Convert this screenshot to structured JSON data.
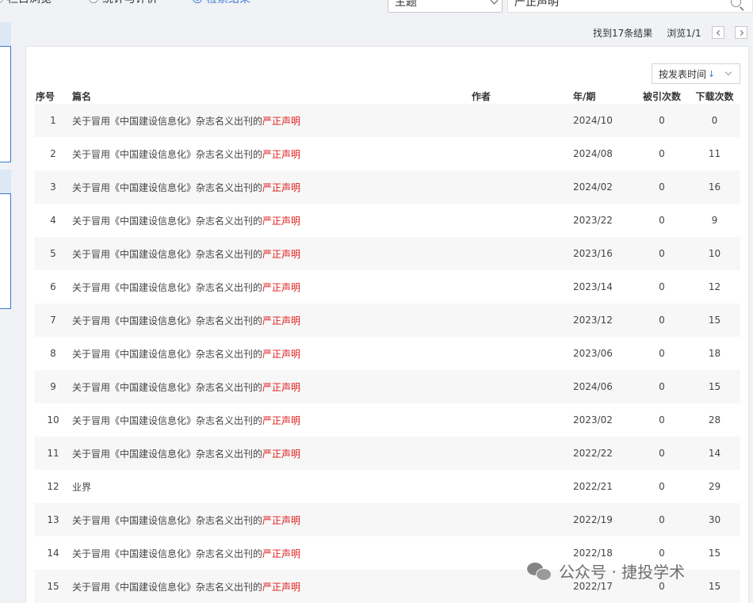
{
  "top": {
    "radios": [
      {
        "label": "栏目浏览",
        "checked": false
      },
      {
        "label": "统计与评价",
        "checked": false
      },
      {
        "label": "检索结果",
        "checked": true
      }
    ],
    "field_select": "主题",
    "search_value": "严正声明"
  },
  "results": {
    "found": "找到17条结果",
    "browse": "浏览1/1"
  },
  "sort": {
    "label": "按发表时间",
    "arrow": "↓"
  },
  "table": {
    "headers": [
      "序号",
      "篇名",
      "作者",
      "年/期",
      "被引次数",
      "下载次数"
    ],
    "rows": [
      {
        "no": "1",
        "title": "关于冒用《中国建设信息化》杂志名义出刊的",
        "hl": "严正声明",
        "author": "",
        "issue": "2024/10",
        "cited": "0",
        "downloads": "0"
      },
      {
        "no": "2",
        "title": "关于冒用《中国建设信息化》杂志名义出刊的",
        "hl": "严正声明",
        "author": "",
        "issue": "2024/08",
        "cited": "0",
        "downloads": "11"
      },
      {
        "no": "3",
        "title": "关于冒用《中国建设信息化》杂志名义出刊的",
        "hl": "严正声明",
        "author": "",
        "issue": "2024/02",
        "cited": "0",
        "downloads": "16"
      },
      {
        "no": "4",
        "title": "关于冒用《中国建设信息化》杂志名义出刊的",
        "hl": "严正声明",
        "author": "",
        "issue": "2023/22",
        "cited": "0",
        "downloads": "9"
      },
      {
        "no": "5",
        "title": "关于冒用《中国建设信息化》杂志名义出刊的",
        "hl": "严正声明",
        "author": "",
        "issue": "2023/16",
        "cited": "0",
        "downloads": "10"
      },
      {
        "no": "6",
        "title": "关于冒用《中国建设信息化》杂志名义出刊的",
        "hl": "严正声明",
        "author": "",
        "issue": "2023/14",
        "cited": "0",
        "downloads": "12"
      },
      {
        "no": "7",
        "title": "关于冒用《中国建设信息化》杂志名义出刊的",
        "hl": "严正声明",
        "author": "",
        "issue": "2023/12",
        "cited": "0",
        "downloads": "15"
      },
      {
        "no": "8",
        "title": "关于冒用《中国建设信息化》杂志名义出刊的",
        "hl": "严正声明",
        "author": "",
        "issue": "2023/06",
        "cited": "0",
        "downloads": "18"
      },
      {
        "no": "9",
        "title": "关于冒用《中国建设信息化》杂志名义出刊的",
        "hl": "严正声明",
        "author": "",
        "issue": "2024/06",
        "cited": "0",
        "downloads": "15"
      },
      {
        "no": "10",
        "title": "关于冒用《中国建设信息化》杂志名义出刊的",
        "hl": "严正声明",
        "author": "",
        "issue": "2023/02",
        "cited": "0",
        "downloads": "28"
      },
      {
        "no": "11",
        "title": "关于冒用《中国建设信息化》杂志名义出刊的",
        "hl": "严正声明",
        "author": "",
        "issue": "2022/22",
        "cited": "0",
        "downloads": "14"
      },
      {
        "no": "12",
        "title": "业界",
        "hl": "",
        "author": "",
        "issue": "2022/21",
        "cited": "0",
        "downloads": "29"
      },
      {
        "no": "13",
        "title": "关于冒用《中国建设信息化》杂志名义出刊的",
        "hl": "严正声明",
        "author": "",
        "issue": "2022/19",
        "cited": "0",
        "downloads": "30"
      },
      {
        "no": "14",
        "title": "关于冒用《中国建设信息化》杂志名义出刊的",
        "hl": "严正声明",
        "author": "",
        "issue": "2022/18",
        "cited": "0",
        "downloads": "15"
      },
      {
        "no": "15",
        "title": "关于冒用《中国建设信息化》杂志名义出刊的",
        "hl": "严正声明",
        "author": "",
        "issue": "2022/17",
        "cited": "0",
        "downloads": "15"
      }
    ]
  },
  "watermark": {
    "text": "公众号 · 捷投学术"
  }
}
